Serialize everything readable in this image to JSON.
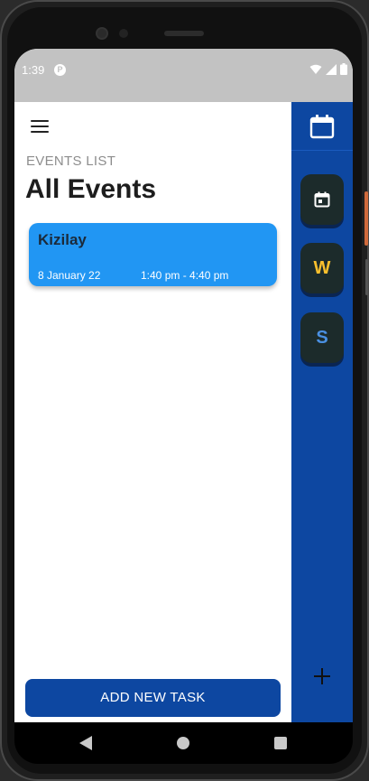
{
  "status_bar": {
    "time": "1:39",
    "app_icon": "notification-icon",
    "icons": [
      "wifi-icon",
      "signal-icon",
      "battery-icon"
    ]
  },
  "header": {
    "menu_icon": "hamburger-menu-icon",
    "section_label": "EVENTS LIST",
    "title": "All Events"
  },
  "events": [
    {
      "title": "Kizilay",
      "date": "8 January 22",
      "time": "1:40 pm - 4:40 pm",
      "color": "#2196f3"
    }
  ],
  "add_button": {
    "label": "ADD NEW TASK",
    "color": "#0d47a1"
  },
  "sidebar": {
    "background": "#0d47a1",
    "top_icon": "calendar-icon",
    "items": [
      {
        "icon": "event-icon",
        "label": ""
      },
      {
        "label": "W",
        "color": "#fbc02d"
      },
      {
        "label": "S",
        "color": "#4a90e2"
      }
    ],
    "add_icon": "plus-icon"
  },
  "nav_bar": {
    "icons": [
      "back-icon",
      "home-icon",
      "recent-apps-icon"
    ]
  }
}
